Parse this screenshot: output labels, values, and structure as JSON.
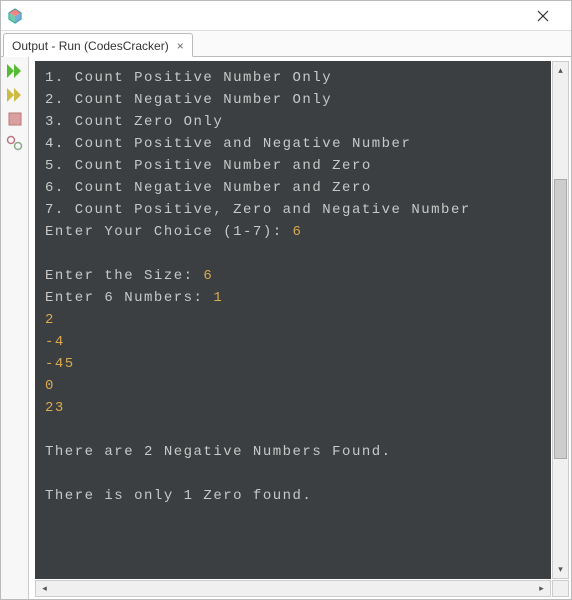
{
  "titlebar": {
    "title": ""
  },
  "tab": {
    "label": "Output - Run (CodesCracker)"
  },
  "sidebar": {
    "items": [
      {
        "name": "run-icon"
      },
      {
        "name": "run-again-icon"
      },
      {
        "name": "stop-icon"
      },
      {
        "name": "settings-icon"
      }
    ]
  },
  "console": {
    "menu": [
      "1. Count Positive Number Only",
      "2. Count Negative Number Only",
      "3. Count Zero Only",
      "4. Count Positive and Negative Number",
      "5. Count Positive Number and Zero",
      "6. Count Negative Number and Zero",
      "7. Count Positive, Zero and Negative Number"
    ],
    "choice_prompt": "Enter Your Choice (1-7): ",
    "choice_value": "6",
    "blank1": "",
    "size_prompt": "Enter the Size: ",
    "size_value": "6",
    "numbers_prompt": "Enter 6 Numbers: ",
    "first_number": "1",
    "rest_numbers": [
      "2",
      "-4",
      "-45",
      "0",
      "23"
    ],
    "blank2": "",
    "result_neg": "There are 2 Negative Numbers Found.",
    "blank3": "",
    "result_zero": "There is only 1 Zero found."
  }
}
